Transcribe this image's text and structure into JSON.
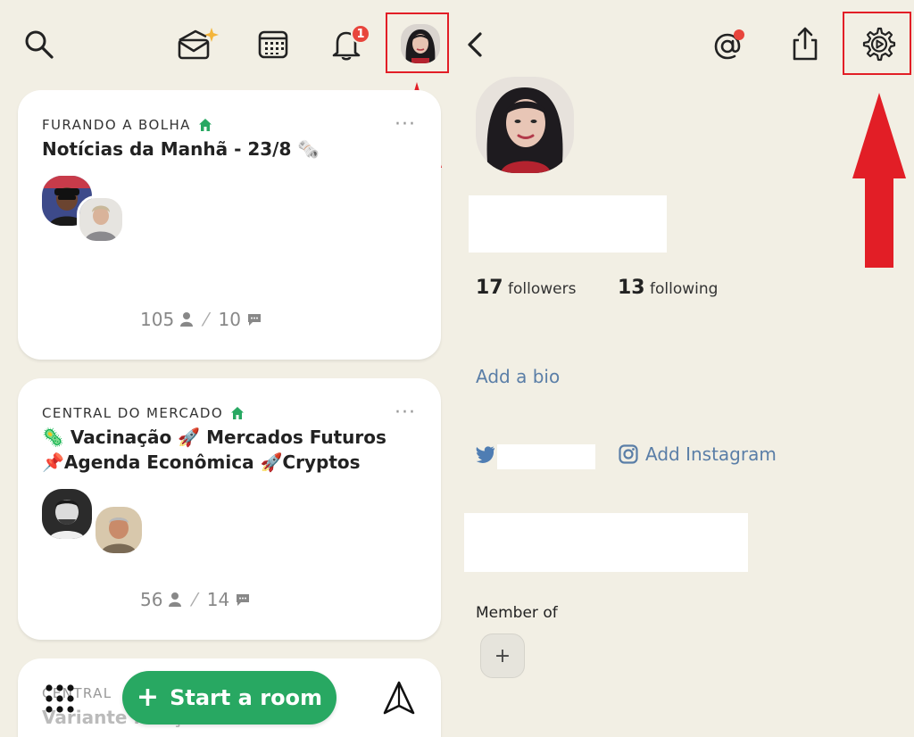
{
  "top_left": {
    "notification_count": "1",
    "icons": [
      "search-icon",
      "invite-envelope-icon",
      "calendar-icon",
      "bell-icon"
    ]
  },
  "rooms": [
    {
      "club": "FURANDO A BOLHA",
      "title": "Notícias da Manhã - 23/8 🗞️",
      "listeners": "105",
      "speakers": "10"
    },
    {
      "club": "CENTRAL DO MERCADO",
      "title_line1": "🦠 Vacinação 🚀 Mercados Futuros",
      "title_line2": "📌Agenda Econômica 🚀Cryptos",
      "listeners": "56",
      "speakers": "14"
    },
    {
      "club": "CENTRAL",
      "title": "Variante ... ação"
    }
  ],
  "bottom": {
    "start_room_label": "Start a room",
    "plus_sign": "+"
  },
  "profile": {
    "followers_count": "17",
    "followers_label": "followers",
    "following_count": "13",
    "following_label": "following",
    "add_bio": "Add a bio",
    "add_instagram": "Add Instagram",
    "member_of": "Member of",
    "add_club": "+"
  },
  "colors": {
    "background": "#f2efe4",
    "accent_green": "#28a862",
    "link_blue": "#5a7ea7",
    "badge_red": "#e8453c",
    "highlight_red": "#e21e26"
  }
}
